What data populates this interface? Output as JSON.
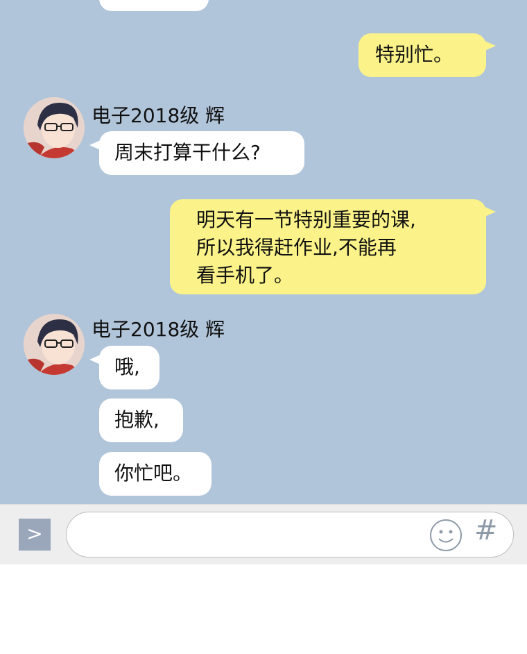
{
  "messages": {
    "m1": "特别忙。",
    "m2_sender": "电子2018级 辉",
    "m2": "周末打算干什么?",
    "m3_line1": "明天有一节特别重要的课,",
    "m3_line2": "所以我得赶作业,不能再",
    "m3_line3": "看手机了。",
    "m4_sender": "电子2018级 辉",
    "m4": "哦,",
    "m5": "抱歉,",
    "m6": "你忙吧。"
  },
  "input_bar": {
    "expand_glyph": ">",
    "input_value": "",
    "input_placeholder": "",
    "emoji_icon": "smiley-icon",
    "hash_glyph": "#"
  }
}
